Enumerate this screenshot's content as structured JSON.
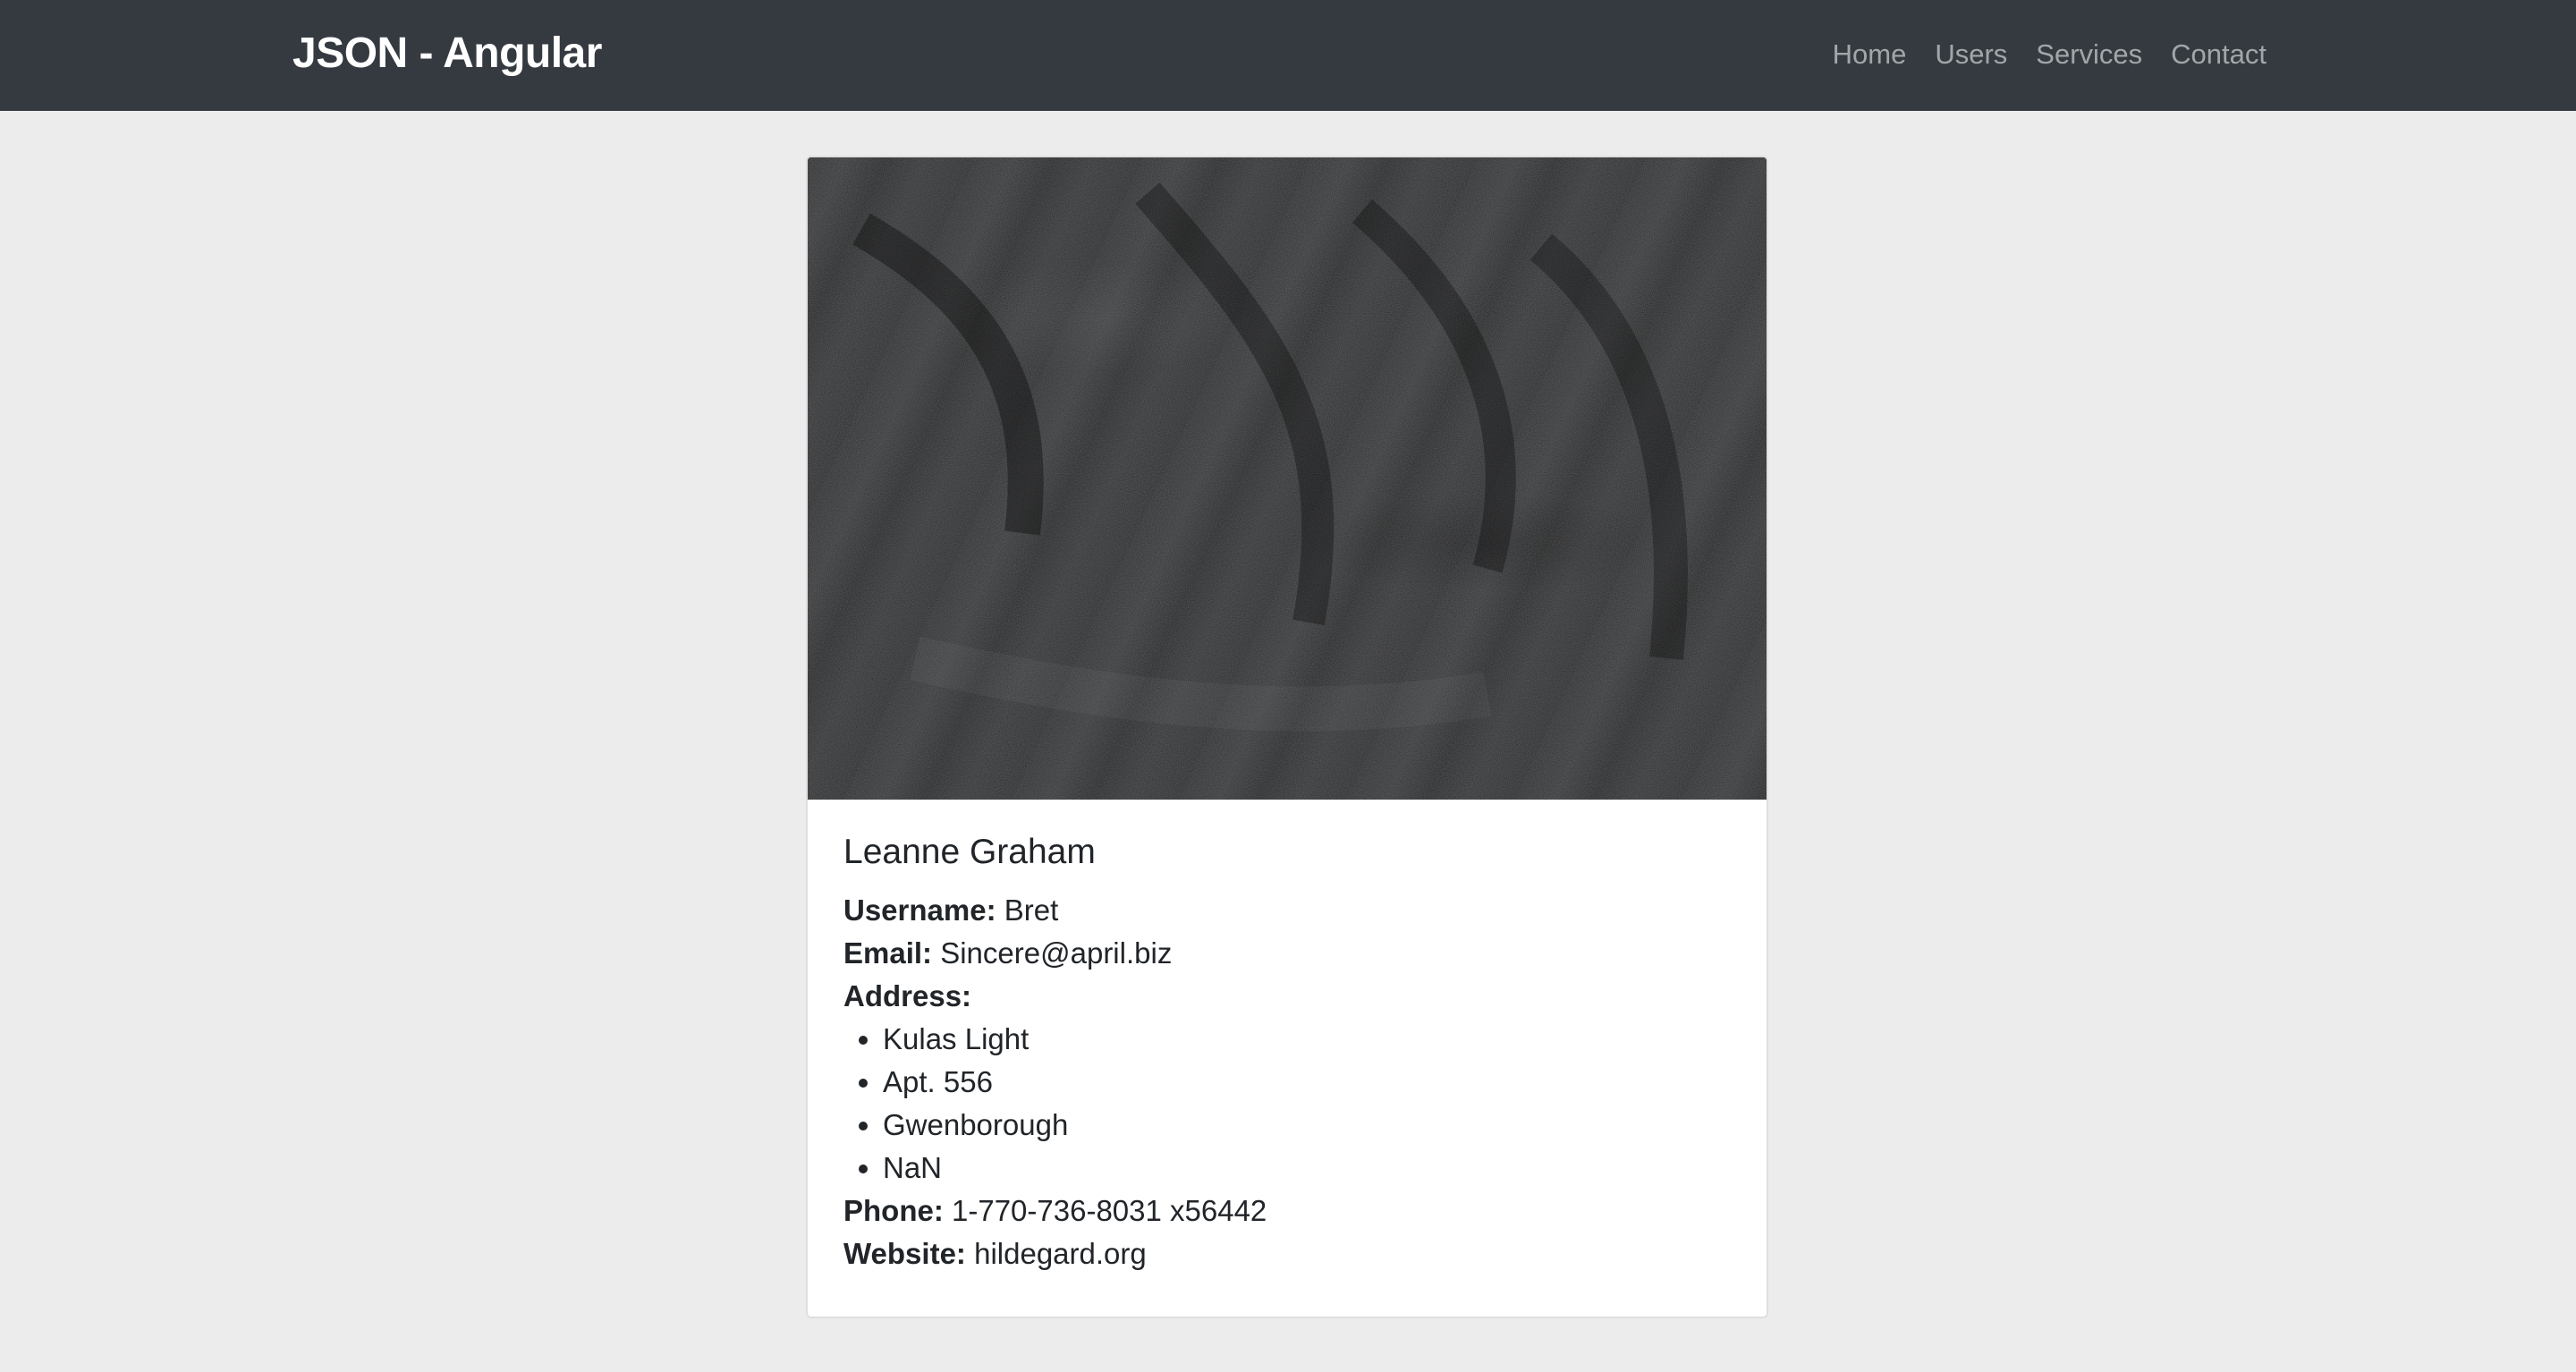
{
  "navbar": {
    "brand": "JSON - Angular",
    "links": [
      "Home",
      "Users",
      "Services",
      "Contact"
    ]
  },
  "card": {
    "name": "Leanne Graham",
    "username_label": "Username:",
    "username": "Bret",
    "email_label": "Email:",
    "email": "Sincere@april.biz",
    "address_label": "Address:",
    "address": [
      "Kulas Light",
      "Apt. 556",
      "Gwenborough",
      "NaN"
    ],
    "phone_label": "Phone:",
    "phone": "1-770-736-8031 x56442",
    "website_label": "Website:",
    "website": "hildegard.org"
  }
}
